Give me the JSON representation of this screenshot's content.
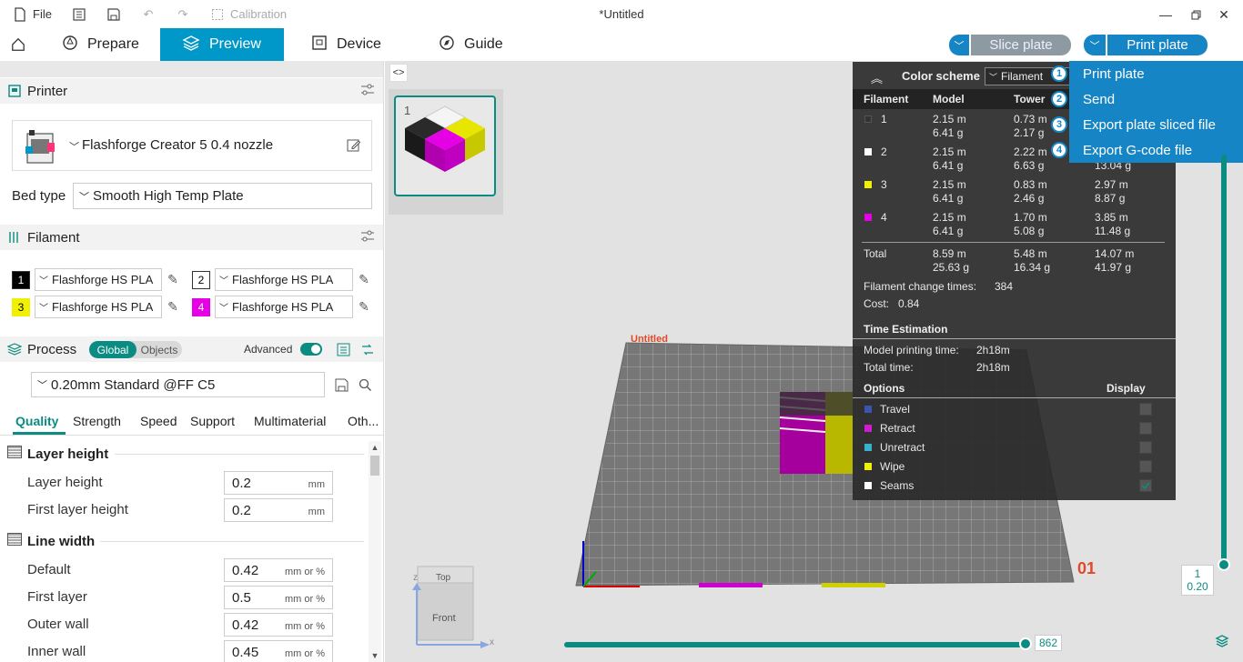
{
  "titlebar": {
    "file_label": "File",
    "calibration_label": "Calibration",
    "title": "*Untitled"
  },
  "tabs": {
    "prepare": "Prepare",
    "preview": "Preview",
    "device": "Device",
    "guide": "Guide"
  },
  "actions": {
    "slice_plate": "Slice plate",
    "print_plate": "Print plate"
  },
  "print_menu": {
    "items": [
      {
        "num": "1",
        "label": "Print plate"
      },
      {
        "num": "2",
        "label": "Send"
      },
      {
        "num": "3",
        "label": "Export plate sliced file"
      },
      {
        "num": "4",
        "label": "Export G-code file"
      }
    ]
  },
  "printer": {
    "section_title": "Printer",
    "name": "Flashforge Creator 5 0.4 nozzle",
    "bed_type_label": "Bed type",
    "bed_type_value": "Smooth High Temp Plate"
  },
  "filament": {
    "section_title": "Filament",
    "slots": [
      {
        "num": "1",
        "name": "Flashforge HS PLA",
        "color": "#000000",
        "text_color": "#ffffff"
      },
      {
        "num": "2",
        "name": "Flashforge HS PLA",
        "color": "#ffffff",
        "text_color": "#000000"
      },
      {
        "num": "3",
        "name": "Flashforge HS PLA",
        "color": "#f0f000",
        "text_color": "#000000"
      },
      {
        "num": "4",
        "name": "Flashforge HS PLA",
        "color": "#e600e6",
        "text_color": "#ffffff"
      }
    ]
  },
  "process": {
    "section_title": "Process",
    "global_label": "Global",
    "objects_label": "Objects",
    "advanced_label": "Advanced",
    "preset": "0.20mm Standard @FF C5",
    "subtabs": [
      "Quality",
      "Strength",
      "Speed",
      "Support",
      "Multimaterial",
      "Oth..."
    ],
    "groups": {
      "layer_height": {
        "title": "Layer height",
        "rows": [
          {
            "label": "Layer height",
            "value": "0.2",
            "unit": "mm"
          },
          {
            "label": "First layer height",
            "value": "0.2",
            "unit": "mm"
          }
        ]
      },
      "line_width": {
        "title": "Line width",
        "rows": [
          {
            "label": "Default",
            "value": "0.42",
            "unit": "mm or %"
          },
          {
            "label": "First layer",
            "value": "0.5",
            "unit": "mm or %"
          },
          {
            "label": "Outer wall",
            "value": "0.42",
            "unit": "mm or %"
          },
          {
            "label": "Inner wall",
            "value": "0.45",
            "unit": "mm or %"
          }
        ]
      }
    }
  },
  "plate": {
    "number": "1",
    "bed_label": "Untitled",
    "plate_id": "01"
  },
  "color_scheme": {
    "title": "Color scheme",
    "mode": "Filament",
    "columns": [
      "Filament",
      "Model",
      "Tower"
    ],
    "rows": [
      {
        "num": "1",
        "color": "#333333",
        "model_len": "2.15 m",
        "model_wt": "6.41 g",
        "tower_len": "0.73 m",
        "tower_wt": "2.17 g",
        "total_len": "",
        "total_wt": ""
      },
      {
        "num": "2",
        "color": "#ffffff",
        "model_len": "2.15 m",
        "model_wt": "6.41 g",
        "tower_len": "2.22 m",
        "tower_wt": "6.63 g",
        "total_len": "",
        "total_wt": "13.04 g"
      },
      {
        "num": "3",
        "color": "#f0f000",
        "model_len": "2.15 m",
        "model_wt": "6.41 g",
        "tower_len": "0.83 m",
        "tower_wt": "2.46 g",
        "total_len": "2.97 m",
        "total_wt": "8.87 g"
      },
      {
        "num": "4",
        "color": "#e600e6",
        "model_len": "2.15 m",
        "model_wt": "6.41 g",
        "tower_len": "1.70 m",
        "tower_wt": "5.08 g",
        "total_len": "3.85 m",
        "total_wt": "11.48 g"
      }
    ],
    "total": {
      "label": "Total",
      "model_len": "8.59 m",
      "model_wt": "25.63 g",
      "tower_len": "5.48 m",
      "tower_wt": "16.34 g",
      "all_len": "14.07 m",
      "all_wt": "41.97 g"
    },
    "change_times_label": "Filament change times:",
    "change_times": "384",
    "cost_label": "Cost:",
    "cost": "0.84",
    "time_title": "Time Estimation",
    "model_time_label": "Model printing time:",
    "model_time": "2h18m",
    "total_time_label": "Total time:",
    "total_time": "2h18m",
    "options_title": "Options",
    "display_title": "Display",
    "options": [
      {
        "label": "Travel",
        "color": "#3a54b0",
        "checked": false
      },
      {
        "label": "Retract",
        "color": "#d21ad2",
        "checked": false
      },
      {
        "label": "Unretract",
        "color": "#3ab0d0",
        "checked": false
      },
      {
        "label": "Wipe",
        "color": "#f0f000",
        "checked": false
      },
      {
        "label": "Seams",
        "color": "#ffffff",
        "checked": true
      }
    ]
  },
  "sliders": {
    "horizontal_value": "862",
    "vertical_top": "1",
    "vertical_bottom": "0.20"
  },
  "view_cube": {
    "top": "Top",
    "front": "Front",
    "x_axis": "x",
    "z_axis": "z"
  }
}
